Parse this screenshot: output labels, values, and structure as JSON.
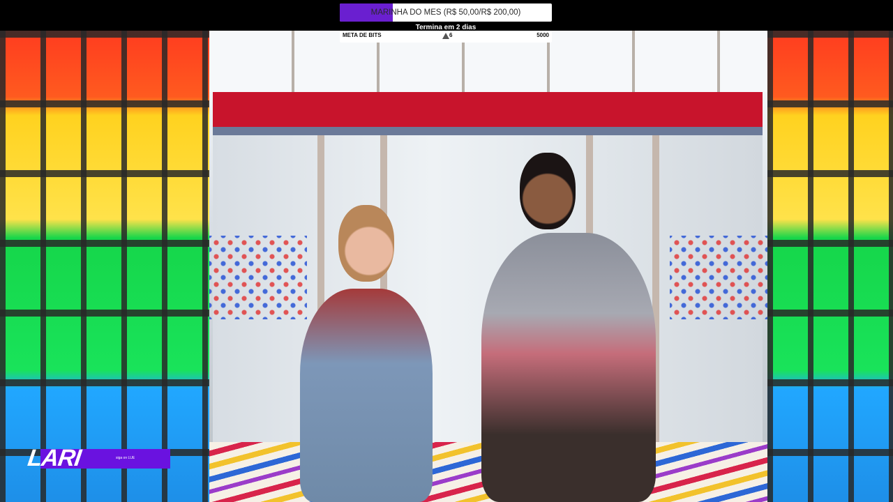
{
  "overlay": {
    "goal": {
      "label": "MARINHA DO MES (R$ 50,00/R$ 200,00)",
      "progress": 0.25,
      "fill_color": "#6a1fd0"
    },
    "ends_text": "Termina em 2 dias",
    "bits": {
      "label": "META DE BITS",
      "current": "6",
      "target": "5000"
    }
  },
  "branding": {
    "logo_text": "LARI",
    "subtext": "siga on LUE",
    "accent": "#6a12e0"
  }
}
